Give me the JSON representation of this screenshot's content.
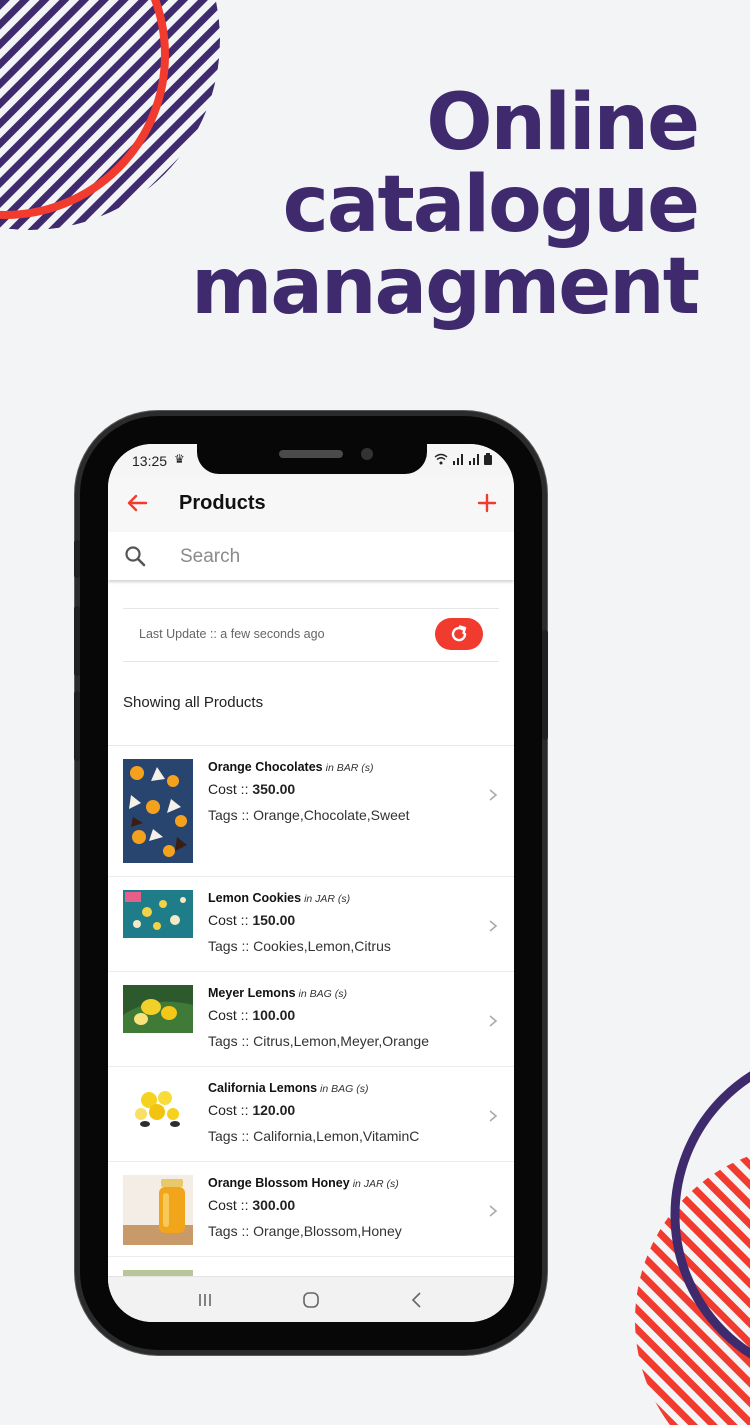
{
  "headline": [
    "Online",
    "catalogue",
    "managment"
  ],
  "status_bar": {
    "time": "13:25",
    "left_icon": "notification-icon",
    "right_icons": [
      "wifi-icon",
      "signal-icon",
      "signal-icon",
      "battery-icon"
    ]
  },
  "app_bar": {
    "title": "Products",
    "back_icon": "arrow-left-icon",
    "add_icon": "plus-icon"
  },
  "search": {
    "placeholder": "Search",
    "value": ""
  },
  "update": {
    "text": "Last Update :: a few seconds ago",
    "button_icon": "refresh-icon"
  },
  "showing_label": "Showing all Products",
  "products": [
    {
      "name": "Orange Chocolates",
      "unit": "in BAR (s)",
      "cost_label": "Cost :: ",
      "cost": "350.00",
      "tags": "Tags :: Orange,Chocolate,Sweet"
    },
    {
      "name": "Lemon Cookies",
      "unit": "in JAR (s)",
      "cost_label": "Cost :: ",
      "cost": "150.00",
      "tags": "Tags :: Cookies,Lemon,Citrus"
    },
    {
      "name": "Meyer Lemons",
      "unit": "in BAG (s)",
      "cost_label": "Cost :: ",
      "cost": "100.00",
      "tags": "Tags :: Citrus,Lemon,Meyer,Orange"
    },
    {
      "name": "California Lemons",
      "unit": "in BAG (s)",
      "cost_label": "Cost :: ",
      "cost": "120.00",
      "tags": "Tags :: California,Lemon,VitaminC"
    },
    {
      "name": "Orange Blossom Honey",
      "unit": "in JAR (s)",
      "cost_label": "Cost :: ",
      "cost": "300.00",
      "tags": "Tags :: Orange,Blossom,Honey"
    }
  ],
  "nav_bar": {
    "icons": [
      "recent-apps-icon",
      "home-icon",
      "back-icon"
    ]
  },
  "colors": {
    "accent": "#f13b2e",
    "headline": "#3f2a6e",
    "background": "#f3f4f6",
    "phone_frame": "#070707"
  }
}
